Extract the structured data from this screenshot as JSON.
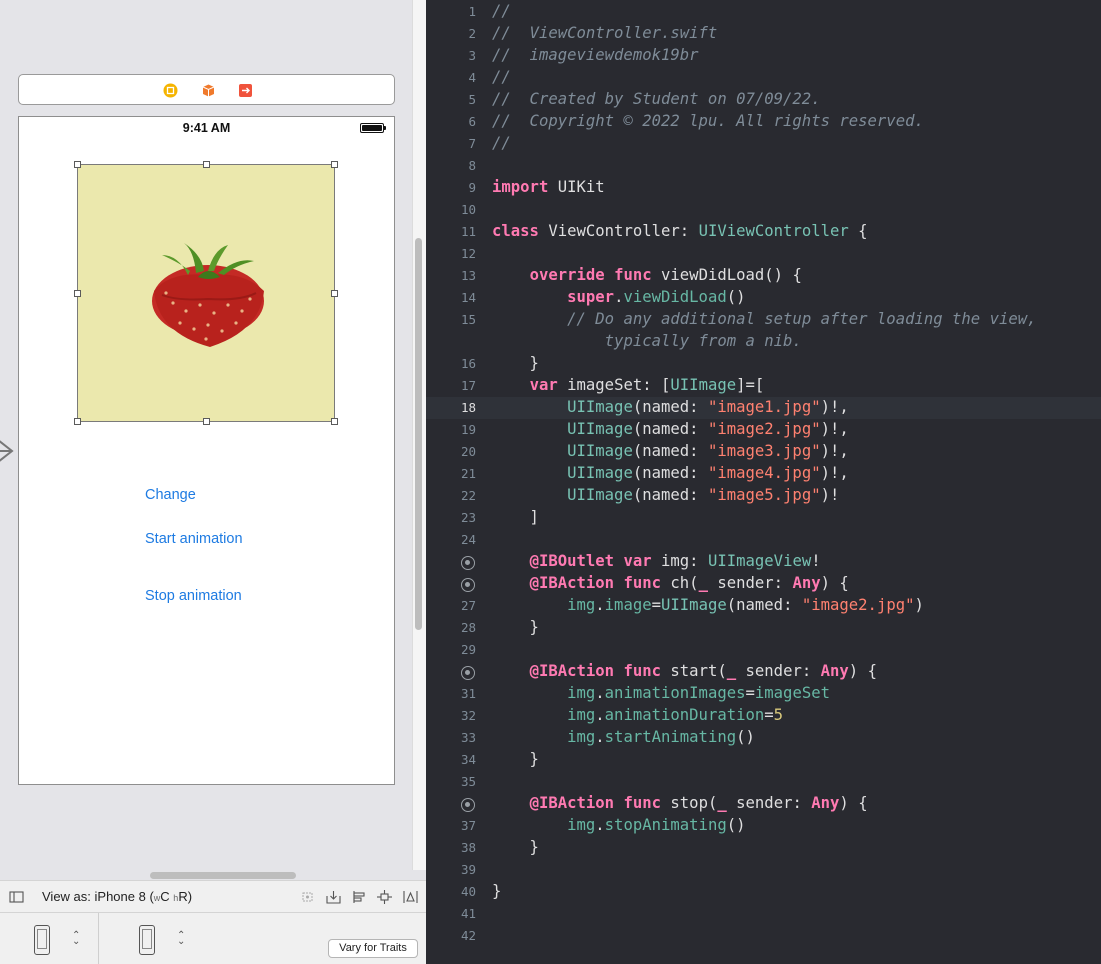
{
  "storyboard": {
    "status_time": "9:41 AM",
    "buttons": {
      "change": "Change",
      "start_animation": "Start animation",
      "stop_animation": "Stop animation"
    },
    "bottom_bar": {
      "view_as_prefix": "View as: iPhone 8 (",
      "w_sub": "w",
      "c": "C",
      "h_sub": "h",
      "r": "R)"
    },
    "vary_for_traits": "Vary for Traits"
  },
  "editor": {
    "lines": [
      {
        "n": "1",
        "segs": [
          [
            "comment",
            "//"
          ]
        ]
      },
      {
        "n": "2",
        "segs": [
          [
            "comment",
            "//  ViewController.swift"
          ]
        ]
      },
      {
        "n": "3",
        "segs": [
          [
            "comment",
            "//  imageviewdemok19br"
          ]
        ]
      },
      {
        "n": "4",
        "segs": [
          [
            "comment",
            "//"
          ]
        ]
      },
      {
        "n": "5",
        "segs": [
          [
            "comment",
            "//  Created by Student on 07/09/22."
          ]
        ]
      },
      {
        "n": "6",
        "segs": [
          [
            "comment",
            "//  Copyright © 2022 lpu. All rights reserved."
          ]
        ]
      },
      {
        "n": "7",
        "segs": [
          [
            "comment",
            "//"
          ]
        ]
      },
      {
        "n": "8",
        "segs": []
      },
      {
        "n": "9",
        "segs": [
          [
            "kw",
            "import"
          ],
          [
            "pl",
            " UIKit"
          ]
        ]
      },
      {
        "n": "10",
        "segs": []
      },
      {
        "n": "11",
        "segs": [
          [
            "kw",
            "class"
          ],
          [
            "pl",
            " ViewController: "
          ],
          [
            "ty",
            "UIViewController"
          ],
          [
            "pl",
            " {"
          ]
        ]
      },
      {
        "n": "12",
        "segs": []
      },
      {
        "n": "13",
        "segs": [
          [
            "pl",
            "    "
          ],
          [
            "kw",
            "override"
          ],
          [
            "pl",
            " "
          ],
          [
            "kw",
            "func"
          ],
          [
            "pl",
            " viewDidLoad() {"
          ]
        ]
      },
      {
        "n": "14",
        "segs": [
          [
            "pl",
            "        "
          ],
          [
            "kw",
            "super"
          ],
          [
            "pl",
            "."
          ],
          [
            "pr",
            "viewDidLoad"
          ],
          [
            "pl",
            "()"
          ]
        ]
      },
      {
        "n": "15",
        "segs": [
          [
            "pl",
            "        "
          ],
          [
            "comment",
            "// Do any additional setup after loading the view,"
          ]
        ]
      },
      {
        "n": "",
        "segs": [
          [
            "pl",
            "            "
          ],
          [
            "comment",
            "typically from a nib."
          ]
        ]
      },
      {
        "n": "16",
        "segs": [
          [
            "pl",
            "    }"
          ]
        ]
      },
      {
        "n": "17",
        "segs": [
          [
            "pl",
            "    "
          ],
          [
            "kw",
            "var"
          ],
          [
            "pl",
            " imageSet: ["
          ],
          [
            "ty",
            "UIImage"
          ],
          [
            "pl",
            "]=["
          ]
        ]
      },
      {
        "n": "18",
        "segs": [
          [
            "pl",
            "        "
          ],
          [
            "ty",
            "UIImage"
          ],
          [
            "pl",
            "(named: "
          ],
          [
            "str",
            "\"image1.jpg\""
          ],
          [
            "pl",
            ")!,"
          ]
        ],
        "active": true
      },
      {
        "n": "19",
        "segs": [
          [
            "pl",
            "        "
          ],
          [
            "ty",
            "UIImage"
          ],
          [
            "pl",
            "(named: "
          ],
          [
            "str",
            "\"image2.jpg\""
          ],
          [
            "pl",
            ")!,"
          ]
        ]
      },
      {
        "n": "20",
        "segs": [
          [
            "pl",
            "        "
          ],
          [
            "ty",
            "UIImage"
          ],
          [
            "pl",
            "(named: "
          ],
          [
            "str",
            "\"image3.jpg\""
          ],
          [
            "pl",
            ")!,"
          ]
        ]
      },
      {
        "n": "21",
        "segs": [
          [
            "pl",
            "        "
          ],
          [
            "ty",
            "UIImage"
          ],
          [
            "pl",
            "(named: "
          ],
          [
            "str",
            "\"image4.jpg\""
          ],
          [
            "pl",
            ")!,"
          ]
        ]
      },
      {
        "n": "22",
        "segs": [
          [
            "pl",
            "        "
          ],
          [
            "ty",
            "UIImage"
          ],
          [
            "pl",
            "(named: "
          ],
          [
            "str",
            "\"image5.jpg\""
          ],
          [
            "pl",
            ")!"
          ]
        ]
      },
      {
        "n": "23",
        "segs": [
          [
            "pl",
            "    ]"
          ]
        ]
      },
      {
        "n": "24",
        "segs": []
      },
      {
        "n": "",
        "marker": true,
        "segs": [
          [
            "pl",
            "    "
          ],
          [
            "kw",
            "@IBOutlet"
          ],
          [
            "pl",
            " "
          ],
          [
            "kw",
            "var"
          ],
          [
            "pl",
            " img: "
          ],
          [
            "ty",
            "UIImageView"
          ],
          [
            "pl",
            "!"
          ]
        ]
      },
      {
        "n": "",
        "marker": true,
        "segs": [
          [
            "pl",
            "    "
          ],
          [
            "kw",
            "@IBAction"
          ],
          [
            "pl",
            " "
          ],
          [
            "kw",
            "func"
          ],
          [
            "pl",
            " ch("
          ],
          [
            "kw",
            "_"
          ],
          [
            "pl",
            " sender: "
          ],
          [
            "kw",
            "Any"
          ],
          [
            "pl",
            ") {"
          ]
        ]
      },
      {
        "n": "27",
        "segs": [
          [
            "pl",
            "        "
          ],
          [
            "pr",
            "img"
          ],
          [
            "pl",
            "."
          ],
          [
            "pr",
            "image"
          ],
          [
            "pl",
            "="
          ],
          [
            "ty",
            "UIImage"
          ],
          [
            "pl",
            "(named: "
          ],
          [
            "str",
            "\"image2.jpg\""
          ],
          [
            "pl",
            ")"
          ]
        ]
      },
      {
        "n": "28",
        "segs": [
          [
            "pl",
            "    }"
          ]
        ]
      },
      {
        "n": "29",
        "segs": []
      },
      {
        "n": "",
        "marker": true,
        "segs": [
          [
            "pl",
            "    "
          ],
          [
            "kw",
            "@IBAction"
          ],
          [
            "pl",
            " "
          ],
          [
            "kw",
            "func"
          ],
          [
            "pl",
            " start("
          ],
          [
            "kw",
            "_"
          ],
          [
            "pl",
            " sender: "
          ],
          [
            "kw",
            "Any"
          ],
          [
            "pl",
            ") {"
          ]
        ]
      },
      {
        "n": "31",
        "segs": [
          [
            "pl",
            "        "
          ],
          [
            "pr",
            "img"
          ],
          [
            "pl",
            "."
          ],
          [
            "pr",
            "animationImages"
          ],
          [
            "pl",
            "="
          ],
          [
            "pr",
            "imageSet"
          ]
        ]
      },
      {
        "n": "32",
        "segs": [
          [
            "pl",
            "        "
          ],
          [
            "pr",
            "img"
          ],
          [
            "pl",
            "."
          ],
          [
            "pr",
            "animationDuration"
          ],
          [
            "pl",
            "="
          ],
          [
            "num",
            "5"
          ]
        ]
      },
      {
        "n": "33",
        "segs": [
          [
            "pl",
            "        "
          ],
          [
            "pr",
            "img"
          ],
          [
            "pl",
            "."
          ],
          [
            "pr",
            "startAnimating"
          ],
          [
            "pl",
            "()"
          ]
        ]
      },
      {
        "n": "34",
        "segs": [
          [
            "pl",
            "    }"
          ]
        ]
      },
      {
        "n": "35",
        "segs": []
      },
      {
        "n": "",
        "marker": true,
        "segs": [
          [
            "pl",
            "    "
          ],
          [
            "kw",
            "@IBAction"
          ],
          [
            "pl",
            " "
          ],
          [
            "kw",
            "func"
          ],
          [
            "pl",
            " stop("
          ],
          [
            "kw",
            "_"
          ],
          [
            "pl",
            " sender: "
          ],
          [
            "kw",
            "Any"
          ],
          [
            "pl",
            ") {"
          ]
        ]
      },
      {
        "n": "37",
        "segs": [
          [
            "pl",
            "        "
          ],
          [
            "pr",
            "img"
          ],
          [
            "pl",
            "."
          ],
          [
            "pr",
            "stopAnimating"
          ],
          [
            "pl",
            "()"
          ]
        ]
      },
      {
        "n": "38",
        "segs": [
          [
            "pl",
            "    }"
          ]
        ]
      },
      {
        "n": "39",
        "segs": []
      },
      {
        "n": "40",
        "segs": [
          [
            "pl",
            "}"
          ]
        ]
      },
      {
        "n": "41",
        "segs": []
      },
      {
        "n": "42",
        "segs": []
      }
    ]
  },
  "icons": {
    "dock": [
      "view-controller-icon",
      "first-responder-icon",
      "exit-icon"
    ],
    "bottom_bar": [
      "toggle-outline-icon",
      "update-frames-icon",
      "embed-in-icon",
      "align-icon",
      "add-constraints-icon",
      "resolve-issues-icon"
    ],
    "device": [
      "iphone-portrait-icon",
      "iphone-portrait-icon"
    ],
    "scene": [
      "strawberry-image",
      "segue-arrow-icon"
    ]
  },
  "colors": {
    "editor_bg": "#292a30",
    "keyword": "#ff7ab2",
    "type": "#78c2b3",
    "string": "#ff8170",
    "comment": "#7f8c98",
    "number": "#d9c97c",
    "button_blue": "#1e7be2",
    "image_bg": "#ebe8ad"
  }
}
